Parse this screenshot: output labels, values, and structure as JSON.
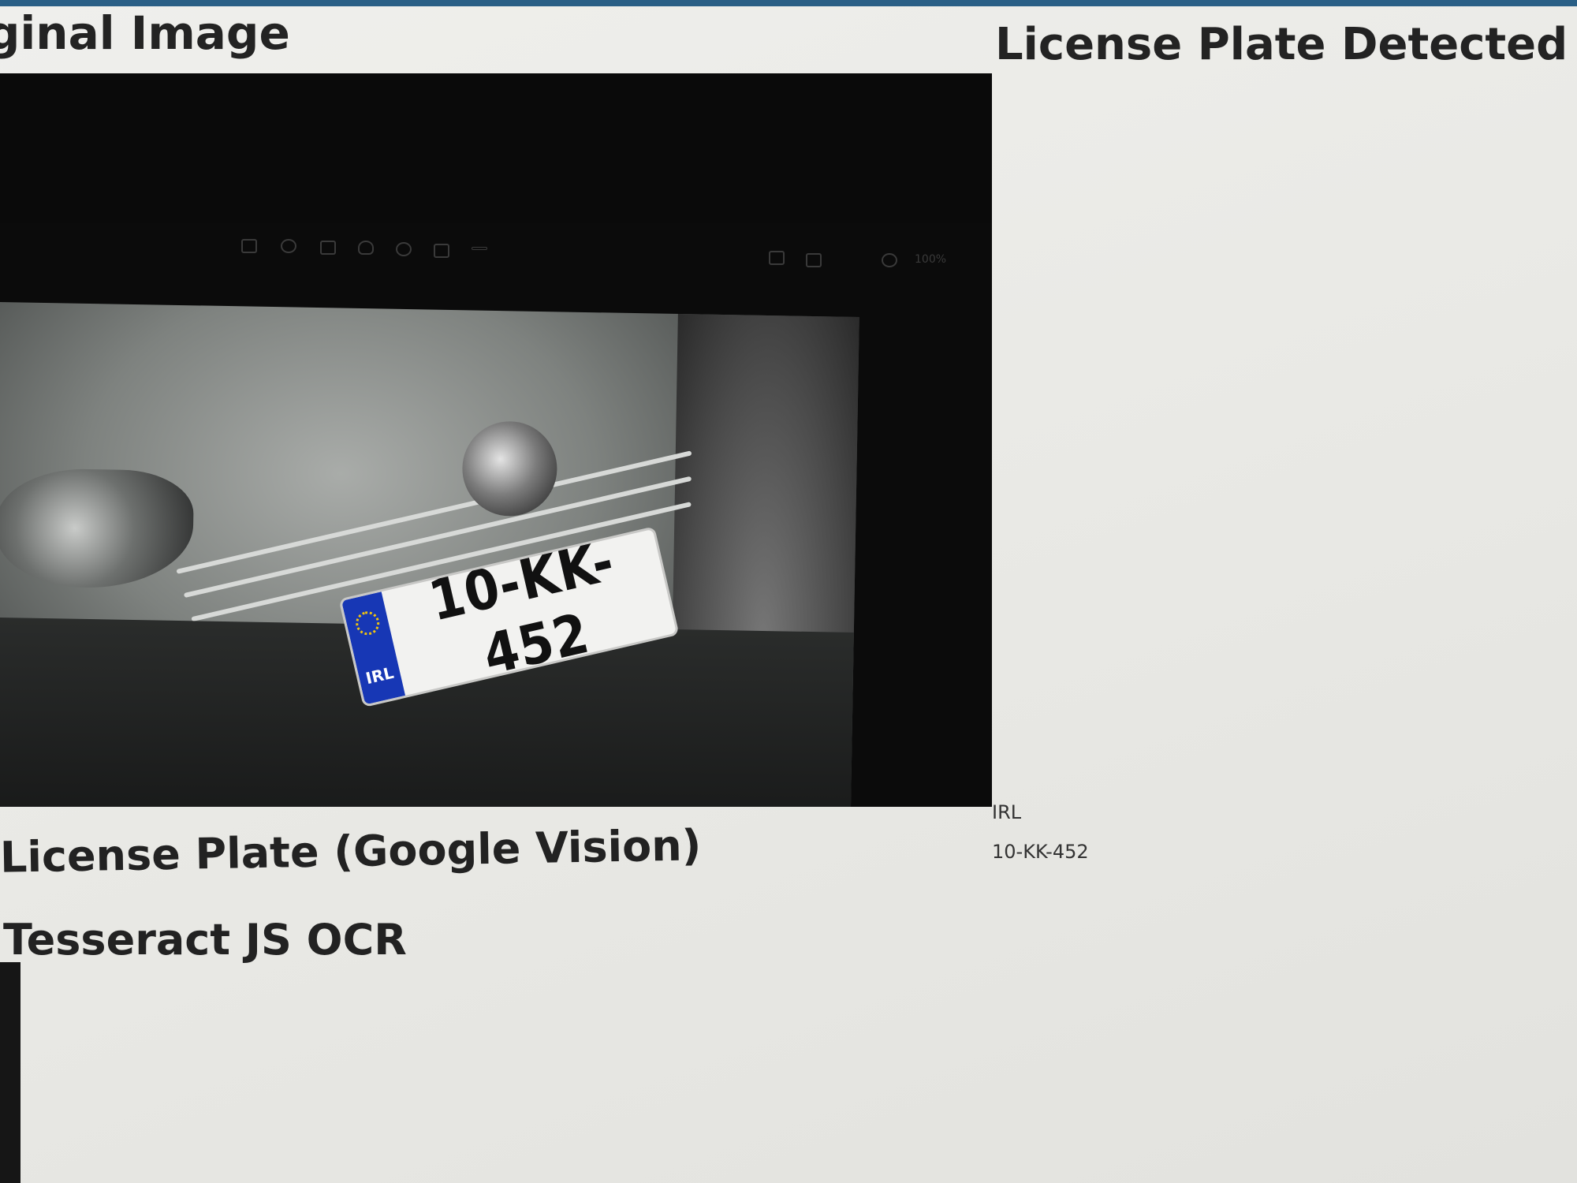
{
  "page": {
    "original_heading": "iginal Image",
    "detected_heading": "License Plate Detected",
    "google_vision_heading": "License Plate (Google Vision)",
    "tesseract_heading": "Tesseract JS OCR"
  },
  "image": {
    "viewer_zoom": "100%",
    "plate_country": "IRL",
    "plate_number": "10-KK-452"
  },
  "results": {
    "country": "IRL",
    "plate": "10-KK-452"
  },
  "colors": {
    "eu_blue": "#1737b5",
    "top_strip": "#2a5f86"
  }
}
